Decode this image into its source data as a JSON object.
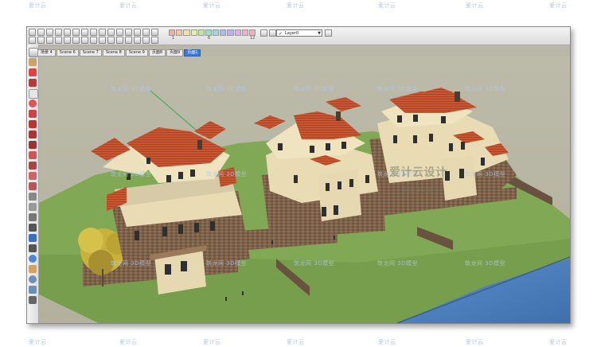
{
  "toolbar": {
    "layer_name": "Layer0",
    "ruler_numbers": [
      "1",
      "2",
      "3",
      "4",
      "5",
      "6",
      "7",
      "8",
      "9",
      "10",
      "11",
      "12"
    ]
  },
  "scene_tabs": [
    "场景 4",
    "Scene 6",
    "Scene 7",
    "Scene 8",
    "Scene 9",
    "页面8",
    "页面9",
    "页面1"
  ],
  "active_tab_index": 7,
  "watermarks": {
    "site_name": "筑龙网 3D模型",
    "edge_text": "爱计云",
    "center_large": "爱计云设计",
    "center_small": "专业3D资料"
  },
  "colors": {
    "sky": "#b7b5a2",
    "lawn": "#7ea653",
    "roof": "#c8572f",
    "stucco": "#efe3c0",
    "stone": "#7e6249",
    "water": "#4e82bf",
    "active_tab": "#3d79d6"
  }
}
